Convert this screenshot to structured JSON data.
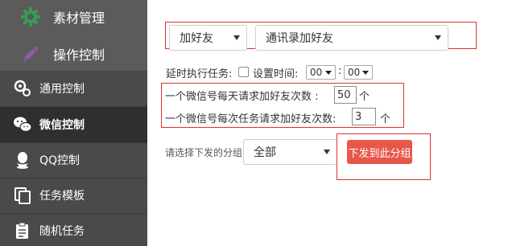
{
  "sidebar": {
    "top_items": [
      {
        "label": "素材管理",
        "icon": "gear-icon"
      },
      {
        "label": "操作控制",
        "icon": "pencil-icon"
      }
    ],
    "items": [
      {
        "label": "通用控制",
        "icon": "settings-icon"
      },
      {
        "label": "微信控制",
        "icon": "wechat-icon",
        "active": true
      },
      {
        "label": "QQ控制",
        "icon": "qq-icon"
      },
      {
        "label": "任务模板",
        "icon": "copy-icon"
      },
      {
        "label": "随机任务",
        "icon": "clipboard-icon"
      }
    ],
    "colors": {
      "background": "#4a4a4a",
      "top_background": "#5b5b5b",
      "active": "#2f2f2f",
      "gear_green": "#3a9b55",
      "pencil_purple": "#8e5aa8"
    }
  },
  "main": {
    "action_select": {
      "value": "加好友"
    },
    "source_select": {
      "value": "通讯录加好友"
    },
    "delay": {
      "label": "延时执行任务:",
      "checkbox_label": "设置时间:",
      "hour": "00",
      "separator": ":",
      "minute": "00"
    },
    "daily_limit": {
      "label": "一个微信号每天请求加好友次数 :",
      "value": "50",
      "unit": "个"
    },
    "task_limit": {
      "label": "一个微信号每次任务请求加好友次数:",
      "value": "3",
      "unit": "个"
    },
    "group": {
      "label": "请选择下发的分组",
      "value": "全部",
      "button": "下发到此分组"
    },
    "colors": {
      "highlight_red": "#e03030",
      "button_red": "#e8574a"
    }
  }
}
